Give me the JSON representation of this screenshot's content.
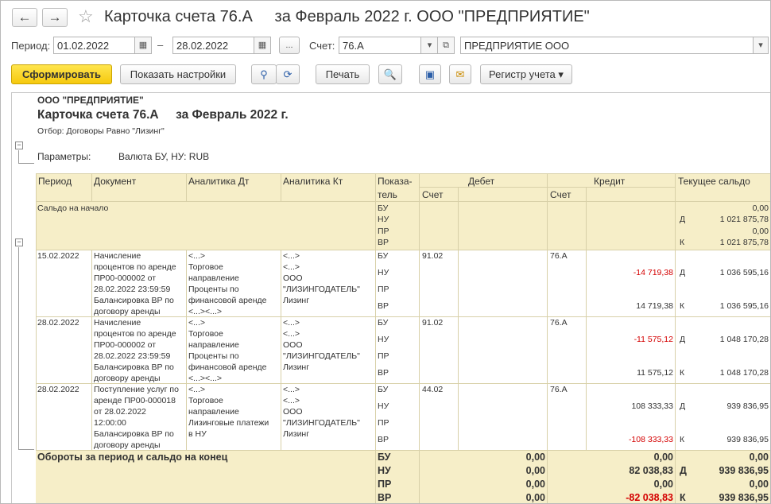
{
  "window": {
    "title": "Карточка счета 76.А     за Февраль 2022 г. ООО \"ПРЕДПРИЯТИЕ\"",
    "back_icon": "←",
    "forward_icon": "→"
  },
  "filters": {
    "period_label": "Период:",
    "date_from": "01.02.2022",
    "dash": "–",
    "date_to": "28.02.2022",
    "dots": "...",
    "account_label": "Счет:",
    "account": "76.А",
    "org": "ПРЕДПРИЯТИЕ ООО"
  },
  "toolbar": {
    "generate": "Сформировать",
    "show_settings": "Показать настройки",
    "print": "Печать",
    "register": "Регистр учета"
  },
  "report": {
    "org": "ООО \"ПРЕДПРИЯТИЕ\"",
    "title": "Карточка счета 76.А     за Февраль 2022 г.",
    "filter": "Отбор: Договоры Равно \"Лизинг\"",
    "params_label": "Параметры:",
    "params_value": "Валюта БУ, НУ: RUB",
    "headers": {
      "period": "Период",
      "document": "Документ",
      "an_dt": "Аналитика Дт",
      "an_kt": "Аналитика Кт",
      "indicator1": "Показа-",
      "indicator2": "тель",
      "debit": "Дебет",
      "credit": "Кредит",
      "balance": "Текущее сальдо",
      "debit_account": "Счет",
      "credit_account": "Счет"
    },
    "opening": {
      "label": "Сальдо на начало",
      "ind": [
        "БУ",
        "НУ",
        "ПР",
        "ВР"
      ],
      "dk": [
        "",
        "Д",
        "",
        "К"
      ],
      "bal": [
        "0,00",
        "1 021 875,78",
        "0,00",
        "1 021 875,78"
      ]
    },
    "rows": [
      {
        "period": "15.02.2022",
        "doc": [
          "Начисление",
          "процентов по аренде",
          "ПР00-000002 от",
          "28.02.2022 23:59:59",
          "Балансировка ВР по",
          "договору аренды"
        ],
        "dt": [
          "<...>",
          "Торговое",
          "направление",
          "Проценты по",
          "финансовой аренде",
          "<...><...>"
        ],
        "kt": [
          "<...>",
          "<...>",
          "ООО",
          "\"ЛИЗИНГОДАТЕЛЬ\"",
          "Лизинг"
        ],
        "ind": [
          "БУ",
          "НУ",
          "ПР",
          "ВР"
        ],
        "dacc": "91.02",
        "cacc": "76.А",
        "credit": [
          "",
          "-14 719,38",
          "",
          "14 719,38"
        ],
        "dk": [
          "",
          "Д",
          "",
          "К"
        ],
        "bal": [
          "",
          "1 036 595,16",
          "",
          "1 036 595,16"
        ]
      },
      {
        "period": "28.02.2022",
        "doc": [
          "Начисление",
          "процентов по аренде",
          "ПР00-000002 от",
          "28.02.2022 23:59:59",
          "Балансировка ВР по",
          "договору аренды"
        ],
        "dt": [
          "<...>",
          "Торговое",
          "направление",
          "Проценты по",
          "финансовой аренде",
          "<...><...>"
        ],
        "kt": [
          "<...>",
          "<...>",
          "ООО",
          "\"ЛИЗИНГОДАТЕЛЬ\"",
          "Лизинг"
        ],
        "ind": [
          "БУ",
          "НУ",
          "ПР",
          "ВР"
        ],
        "dacc": "91.02",
        "cacc": "76.А",
        "credit": [
          "",
          "-11 575,12",
          "",
          "11 575,12"
        ],
        "dk": [
          "",
          "Д",
          "",
          "К"
        ],
        "bal": [
          "",
          "1 048 170,28",
          "",
          "1 048 170,28"
        ]
      },
      {
        "period": "28.02.2022",
        "doc": [
          "Поступление услуг по",
          "аренде ПР00-000018",
          "от 28.02.2022",
          "12:00:00",
          "Балансировка ВР по",
          "договору аренды"
        ],
        "dt": [
          "<...>",
          "Торговое",
          "направление",
          "Лизинговые платежи",
          "в НУ"
        ],
        "kt": [
          "<...>",
          "<...>",
          "ООО",
          "\"ЛИЗИНГОДАТЕЛЬ\"",
          "Лизинг"
        ],
        "ind": [
          "БУ",
          "НУ",
          "ПР",
          "ВР"
        ],
        "dacc": "44.02",
        "cacc": "76.А",
        "credit": [
          "",
          "108 333,33",
          "",
          "-108 333,33"
        ],
        "dk": [
          "",
          "Д",
          "",
          "К"
        ],
        "bal": [
          "",
          "939 836,95",
          "",
          "939 836,95"
        ]
      }
    ],
    "totals": {
      "label": "Обороты за период и сальдо на конец",
      "ind": [
        "БУ",
        "НУ",
        "ПР",
        "ВР"
      ],
      "debit": [
        "0,00",
        "0,00",
        "0,00",
        "0,00"
      ],
      "credit": [
        "0,00",
        "82 038,83",
        "0,00",
        "-82 038,83"
      ],
      "dk": [
        "",
        "Д",
        "",
        "К"
      ],
      "bal": [
        "0,00",
        "939 836,95",
        "0,00",
        "939 836,95"
      ]
    }
  },
  "colors": {
    "header_bg": "#f6eec8",
    "generate_btn": "#f6c90e",
    "negative": "#d40000"
  }
}
